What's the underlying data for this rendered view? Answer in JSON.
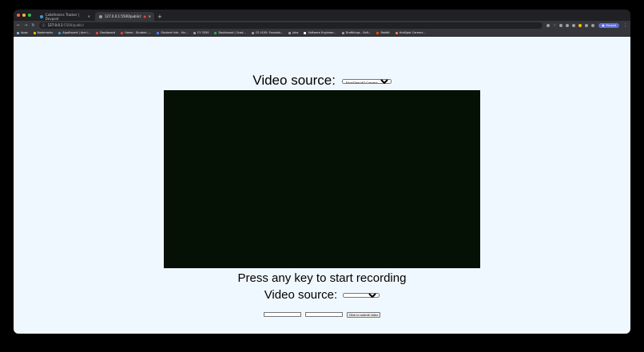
{
  "browser": {
    "tabs": [
      {
        "label": "Calisthenics Tracker | Devpost",
        "active": false,
        "favicon_color": "#3d9ad8"
      },
      {
        "label": "127.0.0.1:5500/public/",
        "active": true,
        "favicon_color": "#9aa0a6"
      }
    ],
    "address": {
      "host": "127.0.0.1",
      "path": ":5500/public/"
    },
    "profile_label": "Paused",
    "bookmarks": [
      {
        "label": "Apps",
        "color": "#8ab4f8"
      },
      {
        "label": "Bookmarks",
        "color": "#fbbc04"
      },
      {
        "label": "AlgoExpert | Ace t...",
        "color": "#3d9ad8"
      },
      {
        "label": "Dashboard",
        "color": "#ea4335"
      },
      {
        "label": "Home - Student -...",
        "color": "#ea4335"
      },
      {
        "label": "Student Hub - Ho...",
        "color": "#4285f4"
      },
      {
        "label": "CY 3550",
        "color": "#9aa0a6"
      },
      {
        "label": "Dashboard | Grad...",
        "color": "#34a853"
      },
      {
        "label": "CS 4100: Foundat...",
        "color": "#9aa0a6"
      },
      {
        "label": "Jobs",
        "color": "#9aa0a6"
      },
      {
        "label": "Software Engineer...",
        "color": "#ffffff"
      },
      {
        "label": "Draftkings - Soft...",
        "color": "#9aa0a6"
      },
      {
        "label": "Reddit",
        "color": "#ff4500"
      },
      {
        "label": "HubSpot Careers...",
        "color": "#ff7a59"
      }
    ]
  },
  "page": {
    "video_source_label": "Video source:",
    "video_source_selected": "FaceTime HD Camera",
    "instruction": "Press any key to start recording",
    "video_source_label_2": "Video source:",
    "video_source_selected_2": "",
    "input1_value": "",
    "input2_value": "",
    "submit_label": "Click to submit video"
  }
}
